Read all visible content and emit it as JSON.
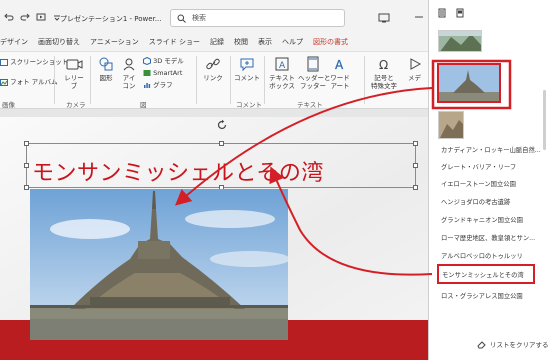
{
  "window": {
    "app_title": "プレゼンテーション1 - Power...",
    "search_placeholder": "検索"
  },
  "ribbon_tabs": [
    "デザイン",
    "画面切り替え",
    "アニメーション",
    "スライド ショー",
    "記録",
    "校閲",
    "表示",
    "ヘルプ",
    "図形の書式"
  ],
  "active_tab": "図形の書式",
  "ribbon": {
    "screenshot_label": "スクリーンショット",
    "photo_album_label": "フォト アルバム",
    "images_group": "画像",
    "camera_label": "レリー\nブ",
    "camera_group": "カメラ",
    "shapes_label": "図形",
    "icons_label": "アイ\nコン",
    "model3d_label": "3D モデル",
    "smartart_label": "SmartArt",
    "graph_label": "グラフ",
    "illust_group": "図",
    "link_label": "リンク",
    "comment_label": "コメント",
    "comment_group": "コメント",
    "textbox_label": "テキスト\nボックス",
    "header_label": "ヘッダーと\nフッター",
    "wordart_label": "ワード\nアート",
    "text_group": "テキスト",
    "symbols_label": "記号と\n特殊文字",
    "media_label": "メデ"
  },
  "slide": {
    "title": "モンサンミッシェルとその湾"
  },
  "selection_pane": {
    "items": [
      "カナディアン・ロッキー山脈自然...",
      "グレート・バリア・リーフ",
      "イエローストーン国立公園",
      "ヘンジョダロの考古遺跡",
      "グランドキャニオン国立公園",
      "ローマ歴史地区、教皇領とサン...",
      "アルベロベッロのトゥルッリ",
      "モンサンミッシェルとその湾",
      "ロス・グラシアレス国立公園"
    ],
    "selected_item": "モンサンミッシェルとその湾",
    "clear_label": "リストをクリアする"
  },
  "colors": {
    "accent_red": "#d41f26",
    "title_red": "#c8161c",
    "slide_bar": "#b91d20"
  }
}
